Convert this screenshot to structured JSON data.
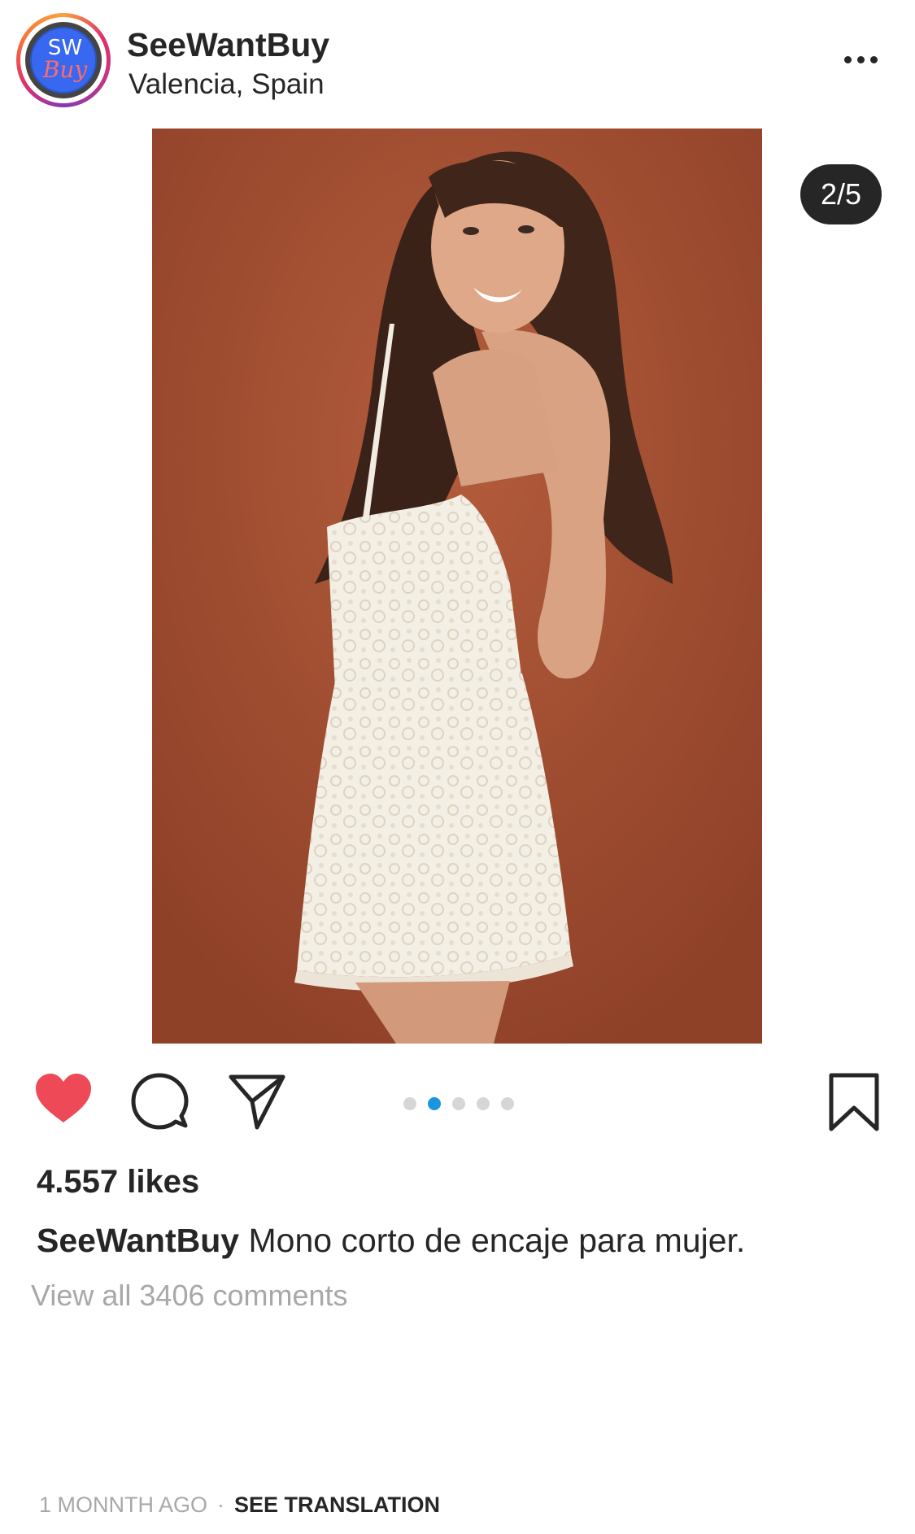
{
  "header": {
    "avatar_text_top": "SW",
    "avatar_text_bottom": "Buy",
    "username": "SeeWantBuy",
    "location": "Valencia, Spain",
    "more_icon": "more-horizontal-icon"
  },
  "post": {
    "image_counter": "2/5",
    "image_description": "Woman in white lace romper against terracotta background",
    "carousel": {
      "total": 5,
      "active_index": 1
    },
    "actions": {
      "like_icon": "heart-filled-icon",
      "comment_icon": "comment-icon",
      "share_icon": "send-icon",
      "save_icon": "bookmark-icon",
      "like_color": "#ed4956",
      "active_dot_color": "#1b95e0"
    },
    "likes": "4.557 likes",
    "caption_user": "SeeWantBuy",
    "caption_text": "Mono corto de encaje para mujer.",
    "view_comments": "View all 3406 comments",
    "time_ago": "1 MONNTH AGO",
    "separator": "·",
    "see_translation": "SEE TRANSLATION"
  }
}
